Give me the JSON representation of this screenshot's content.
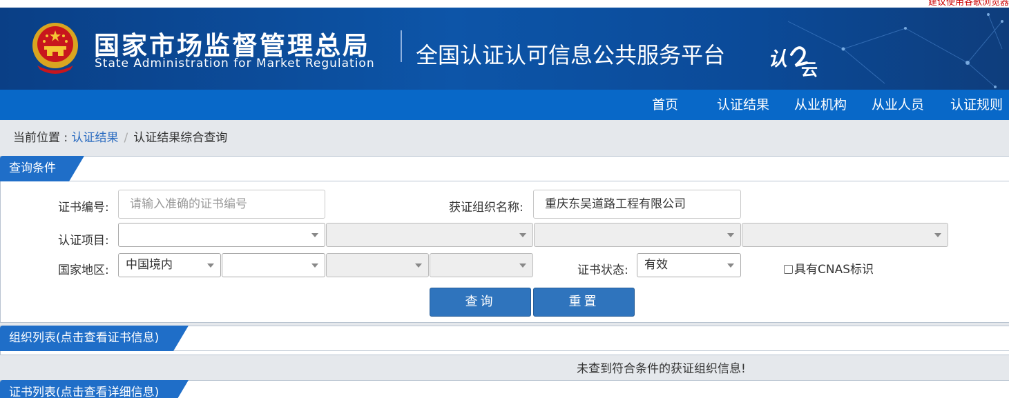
{
  "top_notice": "建议使用谷歌浏览器",
  "header": {
    "org_name_cn": "国家市场监督管理总局",
    "org_name_en": "State Administration  for  Market Regulation",
    "platform_title": "全国认证认可信息公共服务平台",
    "platform_logo_text": "认证云"
  },
  "nav": {
    "items": [
      "首页",
      "认证结果",
      "从业机构",
      "从业人员",
      "认证规则"
    ]
  },
  "breadcrumb": {
    "prefix": "当前位置 : ",
    "link": "认证结果",
    "separator": "/",
    "current": "认证结果综合查询"
  },
  "query": {
    "section_title": "查询条件",
    "cert_no_label": "证书编号:",
    "cert_no_placeholder": "请输入准确的证书编号",
    "cert_no_value": "",
    "org_name_label": "获证组织名称:",
    "org_name_value": "重庆东吴道路工程有限公司",
    "project_label": "认证项目:",
    "project_selects": [
      "",
      "",
      "",
      ""
    ],
    "region_label": "国家地区:",
    "region_selects": [
      "中国境内",
      "",
      "",
      ""
    ],
    "status_label": "证书状态:",
    "status_value": "有效",
    "cnas_label": "具有CNAS标识",
    "search_button": "查询",
    "reset_button": "重置"
  },
  "org_list": {
    "section_title": "组织列表(点击查看证书信息)",
    "empty_message": "未查到符合条件的获证组织信息!"
  },
  "cert_list": {
    "section_title": "证书列表(点击查看详细信息)"
  },
  "colors": {
    "nav_bg": "#0868c8",
    "tab_bg": "#1f6ec8",
    "button_bg": "#2f74bd",
    "link": "#2a6bc0"
  }
}
